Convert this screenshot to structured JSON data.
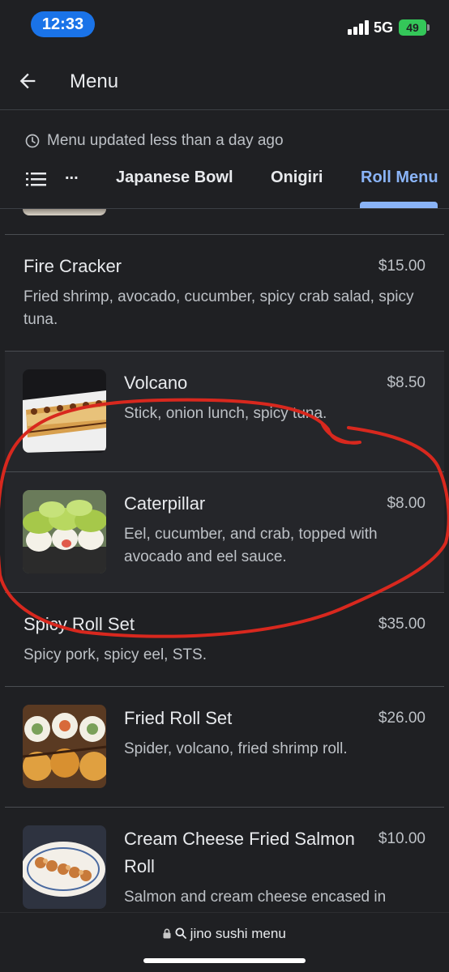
{
  "status_bar": {
    "time": "12:33",
    "network": "5G",
    "battery": "49"
  },
  "app_bar": {
    "title": "Menu"
  },
  "updated_text": "Menu updated less than a day ago",
  "tabs": {
    "overflow": "...",
    "items": [
      "Japanese Bowl",
      "Onigiri",
      "Roll Menu"
    ],
    "active": "Roll Menu"
  },
  "menu_items": [
    {
      "name": "Fire Cracker",
      "price": "$15.00",
      "description": "Fried shrimp, avocado, cucumber, spicy crab salad, spicy tuna."
    },
    {
      "name": "Volcano",
      "price": "$8.50",
      "description": "Stick, onion lunch, spicy tuna."
    },
    {
      "name": "Caterpillar",
      "price": "$8.00",
      "description": "Eel, cucumber, and crab, topped with avocado and eel sauce."
    },
    {
      "name": "Spicy Roll Set",
      "price": "$35.00",
      "description": "Spicy pork, spicy eel, STS."
    },
    {
      "name": "Fried Roll Set",
      "price": "$26.00",
      "description": "Spider, volcano, fried shrimp roll."
    },
    {
      "name": "Cream Cheese Fried Salmon Roll",
      "price": "$10.00",
      "description": "Salmon and cream cheese encased in"
    }
  ],
  "bottom_bar": {
    "url": "jino sushi menu"
  },
  "icons": {
    "back": "arrow-left-icon",
    "clock": "clock-icon",
    "list": "list-icon",
    "lock": "lock-icon",
    "search": "search-icon"
  },
  "colors": {
    "accent": "#8ab4f8",
    "background": "#1f2023",
    "time_pill": "#1a73e8",
    "battery": "#34c759",
    "annotation": "#d8281e"
  }
}
